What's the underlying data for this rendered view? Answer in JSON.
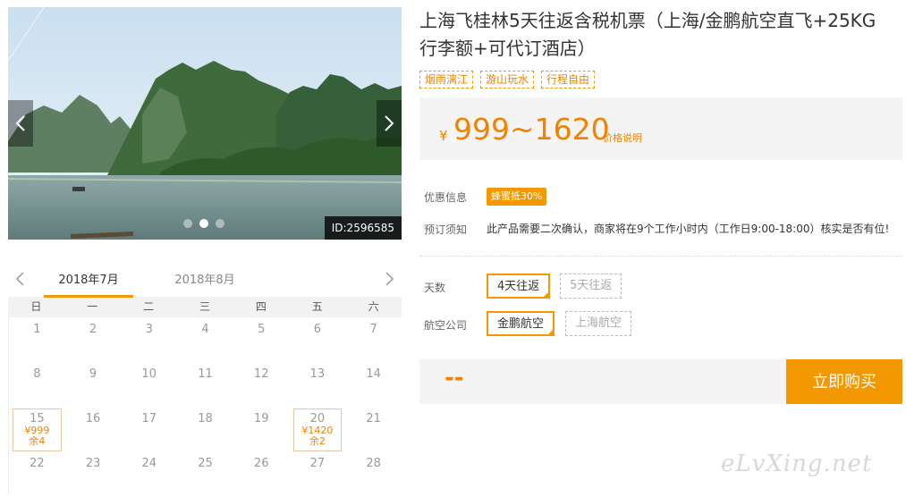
{
  "gallery": {
    "photo_id": "ID:2596585",
    "slide_count": 3,
    "active_slide": 2
  },
  "calendar": {
    "months": [
      "2018年7月",
      "2018年8月"
    ],
    "active_month": 0,
    "weekdays": [
      "日",
      "一",
      "二",
      "三",
      "四",
      "五",
      "六"
    ],
    "days": [
      {
        "d": "1"
      },
      {
        "d": "2"
      },
      {
        "d": "3"
      },
      {
        "d": "4"
      },
      {
        "d": "5"
      },
      {
        "d": "6"
      },
      {
        "d": "7"
      },
      {
        "d": "8"
      },
      {
        "d": "9"
      },
      {
        "d": "10"
      },
      {
        "d": "11"
      },
      {
        "d": "12"
      },
      {
        "d": "13"
      },
      {
        "d": "14"
      },
      {
        "d": "15",
        "price": "¥999",
        "remain": "余4"
      },
      {
        "d": "16"
      },
      {
        "d": "17"
      },
      {
        "d": "18"
      },
      {
        "d": "19"
      },
      {
        "d": "20",
        "price": "¥1420",
        "remain": "余2"
      },
      {
        "d": "21"
      },
      {
        "d": "22"
      },
      {
        "d": "23"
      },
      {
        "d": "24"
      },
      {
        "d": "25"
      },
      {
        "d": "26"
      },
      {
        "d": "27"
      },
      {
        "d": "28"
      }
    ]
  },
  "product": {
    "title": "上海飞桂林5天往返含税机票（上海/金鹏航空直飞+25KG行李额+可代订酒店）",
    "tags": [
      "烟雨漓江",
      "游山玩水",
      "行程自由"
    ],
    "currency_symbol": "¥",
    "price_range": "999~1620",
    "price_explain": "价格说明"
  },
  "info": {
    "promo_label": "优惠信息",
    "promo_badge": "蜂蜜抵30%",
    "notice_label": "预订须知",
    "notice_text": "此产品需要二次确认，商家将在9个工作小时内（工作日9:00-18:00）核实是否有位!"
  },
  "options": {
    "days_label": "天数",
    "days": [
      {
        "label": "4天往返",
        "selected": true
      },
      {
        "label": "5天往返",
        "selected": false
      }
    ],
    "airline_label": "航空公司",
    "airlines": [
      {
        "label": "金鹏航空",
        "selected": true
      },
      {
        "label": "上海航空",
        "selected": false
      }
    ]
  },
  "purchase": {
    "selected_price": "--",
    "buy_label": "立即购买"
  },
  "watermark": "eLvXing.net",
  "colors": {
    "accent": "#f39800",
    "price_text": "#f08200",
    "panel_bg": "#f4f4f4"
  }
}
